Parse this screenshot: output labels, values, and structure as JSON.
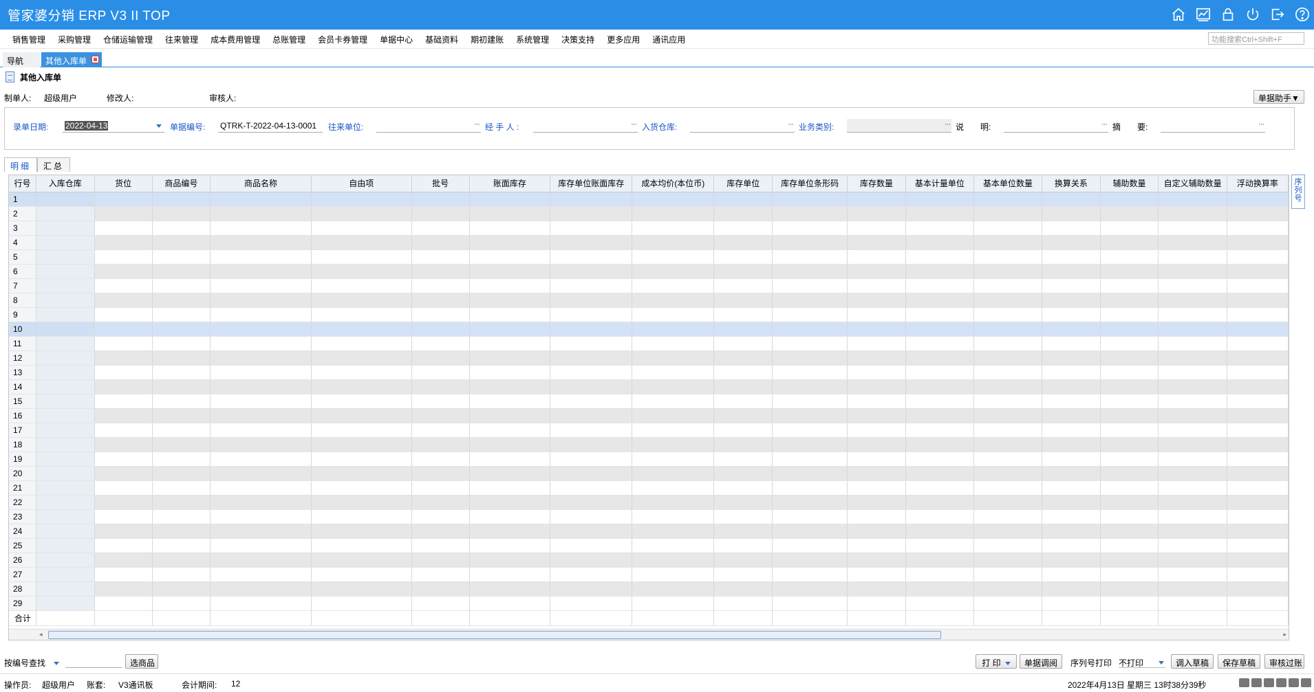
{
  "app": {
    "title": "管家婆分销 ERP V3 II TOP"
  },
  "window_icons": [
    "home-icon",
    "chart-icon",
    "lock-icon",
    "power-icon",
    "exit-icon",
    "help-icon"
  ],
  "menu": [
    "销售管理",
    "采购管理",
    "仓储运输管理",
    "往来管理",
    "成本费用管理",
    "总账管理",
    "会员卡券管理",
    "单据中心",
    "基础资料",
    "期初建账",
    "系统管理",
    "决策支持",
    "更多应用",
    "通讯应用"
  ],
  "search": {
    "placeholder": "功能搜索Ctrl+Shift+F"
  },
  "tabs": {
    "nav": "导航",
    "doc": "其他入库单"
  },
  "document": {
    "title": "其他入库单"
  },
  "meta": {
    "creator_label": "制单人:",
    "creator_value": "超级用户",
    "modifier_label": "修改人:",
    "auditor_label": "审核人:",
    "assistant_button": "单据助手▼"
  },
  "form": {
    "date_label": "录单日期:",
    "date_value": "2022-04-13",
    "number_label": "单据编号:",
    "number_value": "QTRK-T-2022-04-13-0001",
    "partner_label": "往来单位:",
    "handler_label": "经 手 人 :",
    "warehouse_label": "入货仓库:",
    "business_label": "业务类别:",
    "note_label": "说　　明:",
    "summary_label": "摘　　要:",
    "dots": "···"
  },
  "subtabs": [
    "明细",
    "汇总"
  ],
  "grid": {
    "columns": [
      "行号",
      "入库仓库",
      "货位",
      "商品编号",
      "商品名称",
      "自由项",
      "批号",
      "账面库存",
      "库存单位账面库存",
      "成本均价(本位币)",
      "库存单位",
      "库存单位条形码",
      "库存数量",
      "基本计量单位",
      "基本单位数量",
      "换算关系",
      "辅助数量",
      "自定义辅助数量",
      "浮动换算率"
    ],
    "rows": [
      "1",
      "2",
      "3",
      "4",
      "5",
      "6",
      "7",
      "8",
      "9",
      "10",
      "11",
      "12",
      "13",
      "14",
      "15",
      "16",
      "17",
      "18",
      "19",
      "20",
      "21",
      "22",
      "23",
      "24",
      "25",
      "26",
      "27",
      "28",
      "29"
    ],
    "selected_rows": [
      "1",
      "10"
    ],
    "total_label": "合计"
  },
  "side_tab": "序列号",
  "bottom": {
    "lookup_label": "按编号查找",
    "select_goods": "选商品",
    "print": "打 印",
    "doc_query": "单据调阅",
    "serial_print_label": "序列号打印",
    "serial_print_value": "不打印",
    "load_draft": "调入草稿",
    "save_draft": "保存草稿",
    "audit_post": "审核过账"
  },
  "status": {
    "operator_label": "操作员:",
    "operator_value": "超级用户",
    "account_label": "账套:",
    "account_value": "V3通讯板",
    "period_label": "会计期间:",
    "period_value": "12",
    "datetime": "2022年4月13日 星期三 13时38分39秒"
  }
}
